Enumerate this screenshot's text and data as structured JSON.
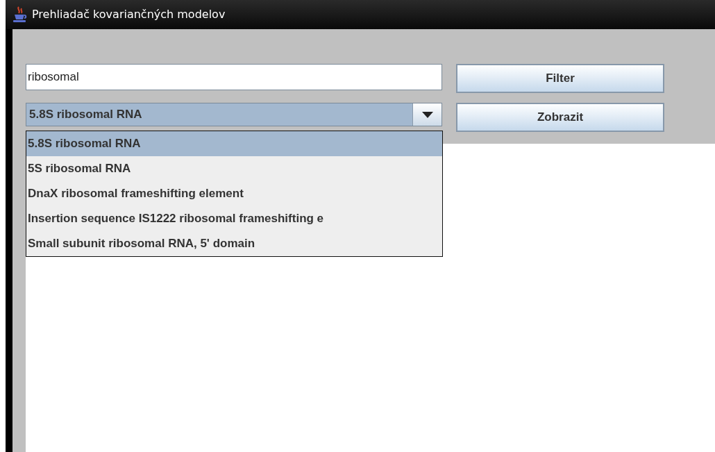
{
  "window": {
    "title": "Prehliadač kovariančných modelov"
  },
  "search": {
    "value": "ribosomal"
  },
  "combo": {
    "value": "5.8S ribosomal RNA",
    "expanded": true,
    "options": [
      {
        "label": "5.8S ribosomal RNA",
        "selected": true
      },
      {
        "label": "5S ribosomal RNA",
        "selected": false
      },
      {
        "label": "DnaX ribosomal frameshifting element",
        "selected": false
      },
      {
        "label": "Insertion sequence IS1222 ribosomal frameshifting e",
        "selected": false
      },
      {
        "label": "Small subunit ribosomal RNA, 5' domain",
        "selected": false
      }
    ]
  },
  "buttons": [
    {
      "label": "Filter"
    },
    {
      "label": "Zobrazit"
    }
  ]
}
